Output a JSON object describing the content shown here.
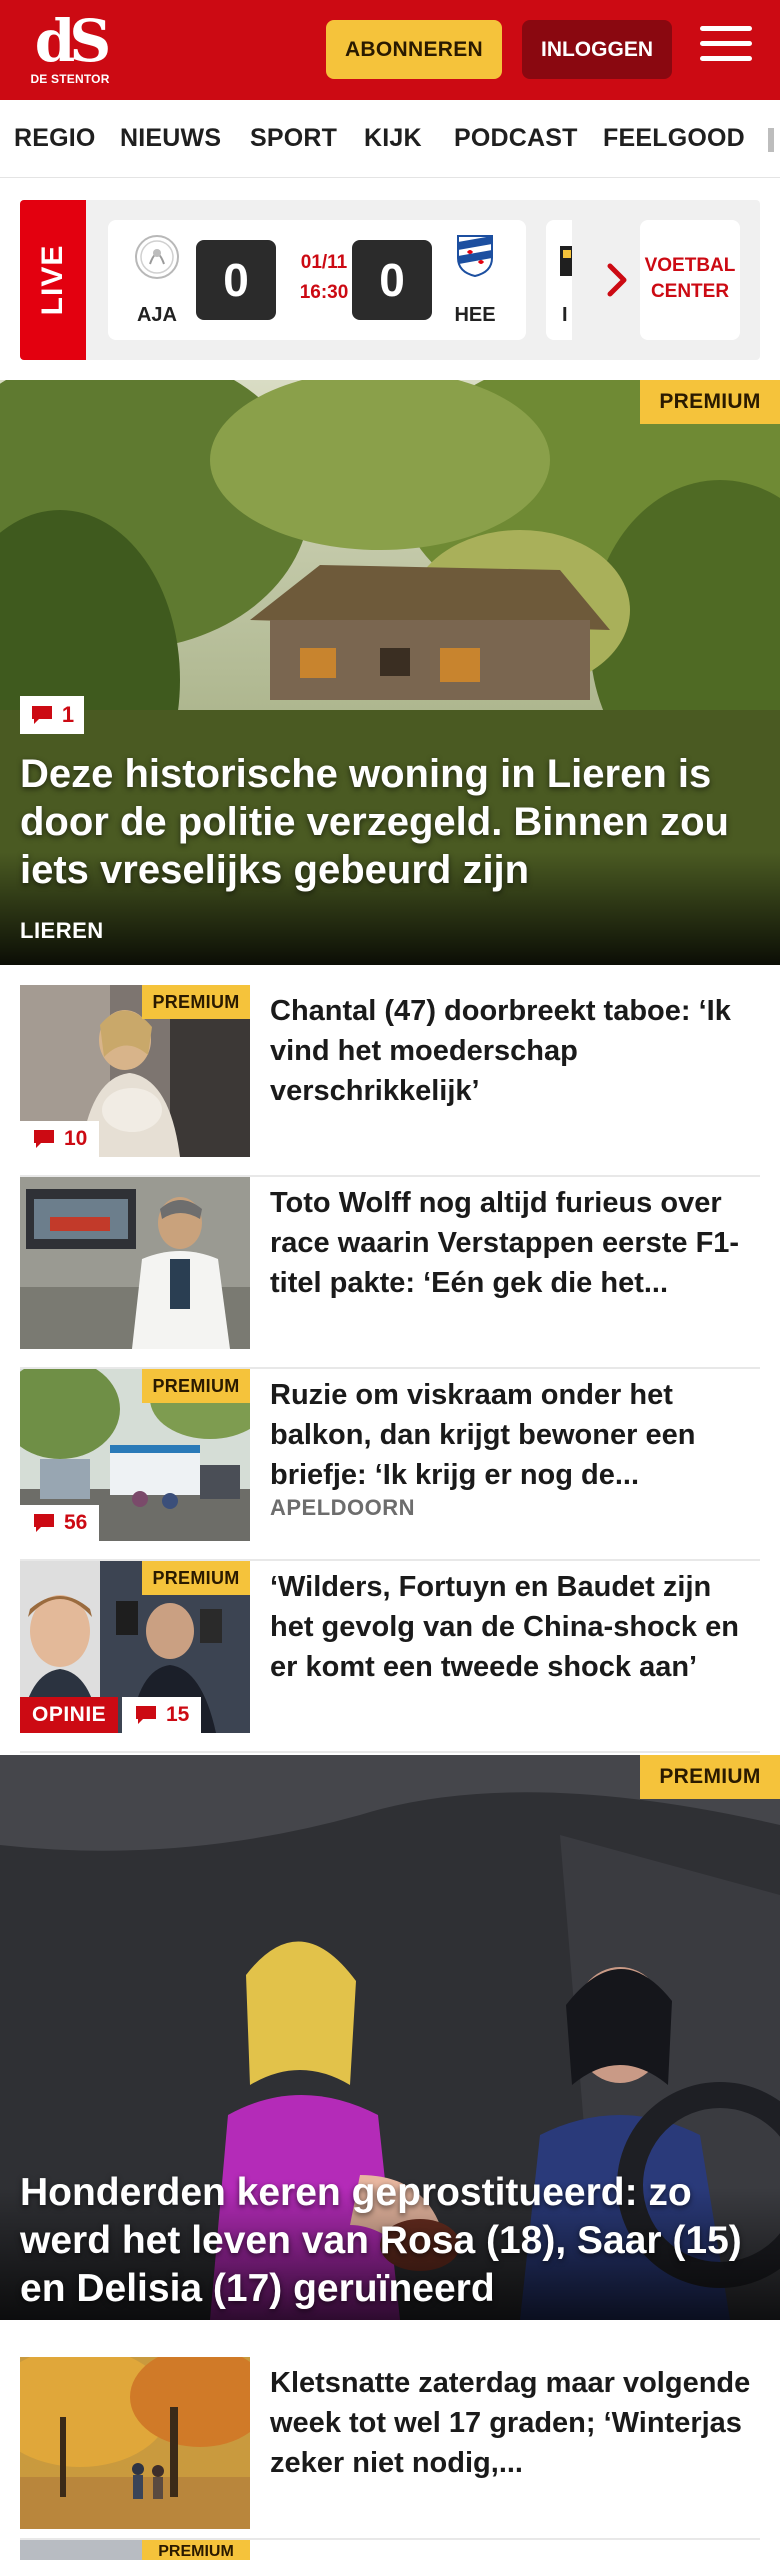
{
  "header": {
    "logo_mark": "dS",
    "logo_sub": "DE STENTOR",
    "subscribe_label": "ABONNEREN",
    "login_label": "INLOGGEN",
    "brand_color": "#cc0a13",
    "accent_color": "#f5c33b"
  },
  "nav": {
    "items": [
      "REGIO",
      "NIEUWS",
      "SPORT",
      "KIJK",
      "PODCAST",
      "FEELGOOD"
    ]
  },
  "live": {
    "label": "LIVE",
    "match": {
      "home_code": "AJA",
      "home_score": "0",
      "date": "01/11",
      "time": "16:30",
      "away_score": "0",
      "away_code": "HEE"
    },
    "partial_card_letter": "I",
    "voetbal_center_line1": "VOETBAL",
    "voetbal_center_line2": "CENTER"
  },
  "hero": {
    "premium": "PREMIUM",
    "comments": "1",
    "title": "Deze historische woning in Lieren is door de politie verzegeld. Binnen zou iets vreselijks gebeurd zijn",
    "location": "LIEREN"
  },
  "articles": [
    {
      "premium": "PREMIUM",
      "comments": "10",
      "title": "Chantal (47) doorbreekt taboe: ‘Ik vind het moederschap verschrikkelijk’",
      "location": ""
    },
    {
      "premium": "",
      "comments": "",
      "title": "Toto Wolff nog altijd furieus over race waarin Verstappen eerste F1-titel pakte: ‘Eén gek die het...",
      "location": ""
    },
    {
      "premium": "PREMIUM",
      "comments": "56",
      "title": "Ruzie om viskraam onder het balkon, dan krijgt bewoner een briefje: ‘Ik krijg er nog de...",
      "location": "APELDOORN"
    },
    {
      "premium": "PREMIUM",
      "comments": "15",
      "tag": "OPINIE",
      "title": "‘Wilders, Fortuyn en Baudet zijn het gevolg van de China-shock en er komt een tweede shock aan’",
      "location": ""
    }
  ],
  "hero2": {
    "premium": "PREMIUM",
    "title": "Honderden keren geprostitueerd: zo werd het leven van Rosa (18), Saar (15) en Delisia (17) geruïneerd"
  },
  "article_after": {
    "title": "Kletsnatte zaterdag maar volgende week tot wel 17 graden; ‘Winterjas zeker niet nodig,...",
    "partial_premium": "PREMIUM"
  }
}
